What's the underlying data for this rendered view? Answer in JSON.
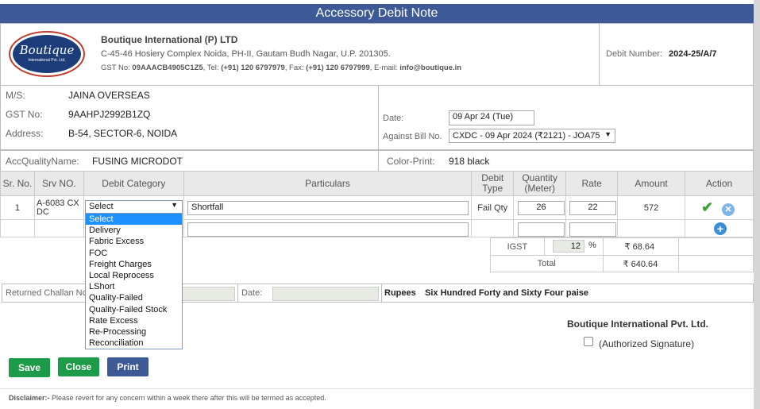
{
  "title": "Accessory Debit Note",
  "company": {
    "logo_text_1": "Boutique",
    "logo_text_2": "International Pvt. Ltd.",
    "name": "Boutique International (P) LTD",
    "address": "C-45-46 Hosiery Complex Noida, PH-II, Gautam Budh Nagar, U.P. 201305.",
    "gst_label": "GST No:",
    "gst": "09AAACB4905C1Z5",
    "tel_label": "Tel:",
    "tel": "(+91) 120 6797979",
    "fax_label": "Fax:",
    "fax": "(+91) 120 6797999",
    "email_label": "E-mail:",
    "email": "info@boutique.in"
  },
  "debit_number": {
    "label": "Debit Number:",
    "value": "2024-25/A/7"
  },
  "party": {
    "ms_label": "M/S:",
    "ms": "JAINA OVERSEAS",
    "gst_label": "GST No:",
    "gst": "9AAHPJ2992B1ZQ",
    "address_label": "Address:",
    "address": "B-54, SECTOR-6, NOIDA"
  },
  "date": {
    "label": "Date:",
    "value": "09 Apr 24 (Tue)"
  },
  "against_bill": {
    "label": "Against Bill No.",
    "value": "CXDC - 09 Apr 2024 (₹2121) - JOA75"
  },
  "acc_quality": {
    "label": "AccQualityName:",
    "value": "FUSING MICRODOT"
  },
  "color_print": {
    "label": "Color-Print:",
    "value": "918 black"
  },
  "table": {
    "headers": {
      "sr": "Sr. No.",
      "srv": "Srv NO.",
      "category": "Debit Category",
      "particulars": "Particulars",
      "type_1": "Debit",
      "type_2": "Type",
      "qty_1": "Quantity",
      "qty_2": "(Meter)",
      "rate": "Rate",
      "amount": "Amount",
      "action": "Action"
    },
    "row": {
      "sr": "1",
      "srv": "A-6083 CX DC",
      "category": "Select",
      "particulars": "Shortfall",
      "type": "Fail Qty",
      "qty": "26",
      "rate": "22",
      "amount": "572"
    }
  },
  "dropdown_options": [
    "Select",
    "Delivery",
    "Fabric Excess",
    "FOC",
    "Freight Charges",
    "Local Reprocess",
    "LShort",
    "Quality-Failed",
    "Quality-Failed Stock",
    "Rate Excess",
    "Re-Processing",
    "Reconciliation"
  ],
  "tax": {
    "igst_label": "IGST",
    "igst_rate": "12",
    "pct": "%",
    "igst_amount": "₹ 68.64",
    "total_label": "Total",
    "total_amount": "₹ 640.64"
  },
  "challan": {
    "label": "Returned Challan No",
    "date_label": "Date:"
  },
  "rupees": {
    "label": "Rupees",
    "words": "Six Hundred Forty and Sixty Four paise"
  },
  "signature": {
    "company": "Boutique International Pvt. Ltd.",
    "label": "(Authorized Signature)"
  },
  "buttons": {
    "save": "Save",
    "close": "Close",
    "print": "Print"
  },
  "disclaimer": {
    "label": "Disclaimer:-",
    "text": "Please revert for any concern within a week there after this will be termed as accepted."
  },
  "colors": {
    "title_bar": "#3d5a96",
    "save": "#1e9b48",
    "close": "#1e9b48",
    "print": "#3d5a96",
    "dropdown_selected": "#1e90ff"
  }
}
